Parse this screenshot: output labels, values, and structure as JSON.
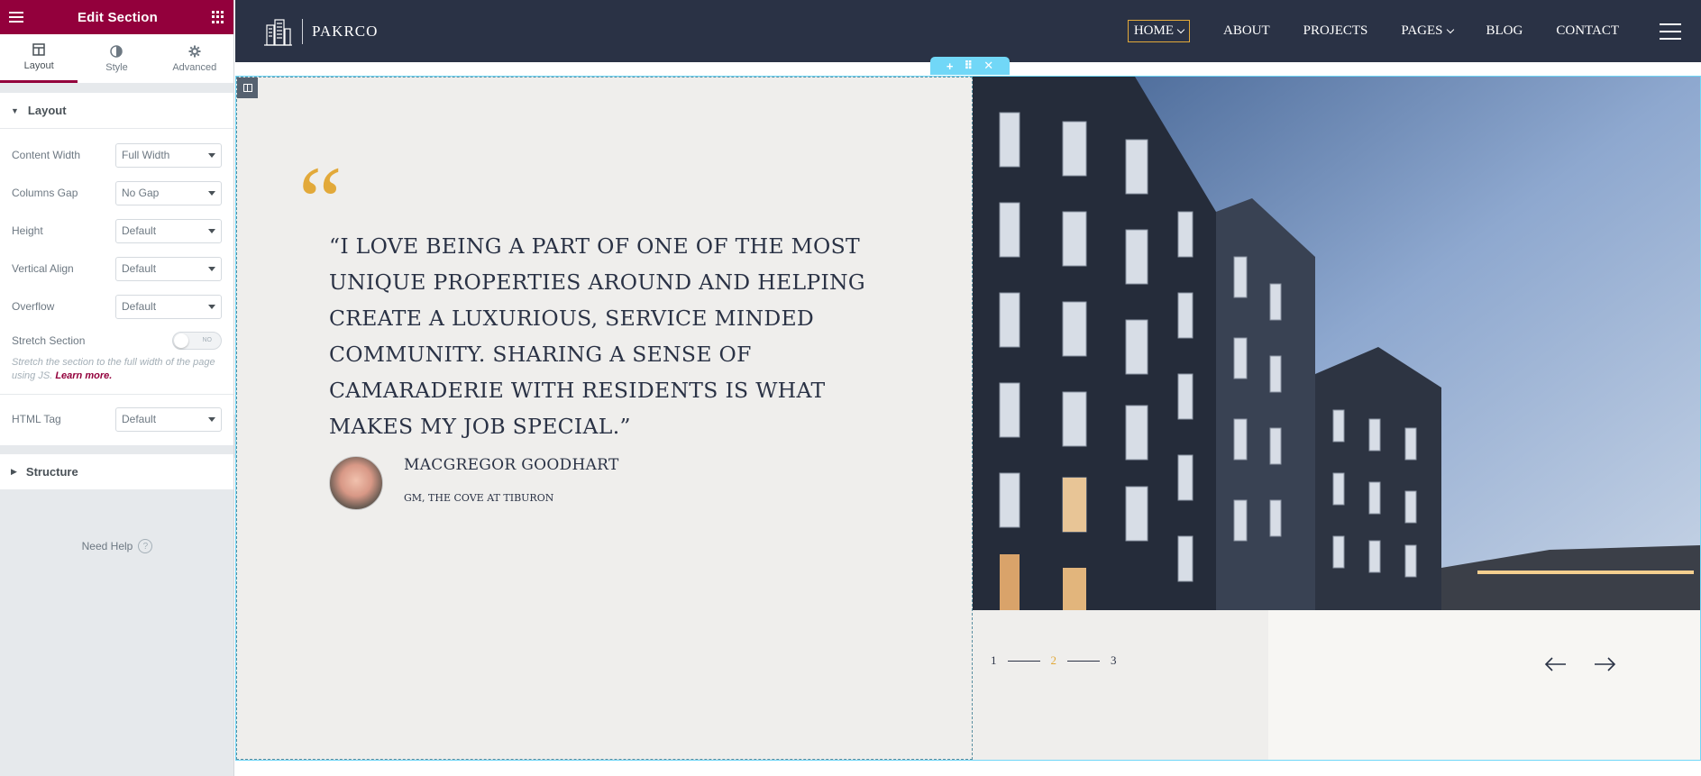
{
  "panel": {
    "title": "Edit Section",
    "tabs": [
      {
        "label": "Layout",
        "icon": "layout-icon"
      },
      {
        "label": "Style",
        "icon": "style-icon"
      },
      {
        "label": "Advanced",
        "icon": "gear-icon"
      }
    ],
    "layout_section_title": "Layout",
    "controls": {
      "content_width": {
        "label": "Content Width",
        "value": "Full Width"
      },
      "columns_gap": {
        "label": "Columns Gap",
        "value": "No Gap"
      },
      "height": {
        "label": "Height",
        "value": "Default"
      },
      "vertical_align": {
        "label": "Vertical Align",
        "value": "Default"
      },
      "overflow": {
        "label": "Overflow",
        "value": "Default"
      },
      "stretch_section": {
        "label": "Stretch Section",
        "toggle_text": "NO"
      },
      "html_tag": {
        "label": "HTML Tag",
        "value": "Default"
      }
    },
    "stretch_hint": "Stretch the section to the full width of the page using JS.",
    "learn_more": "Learn more.",
    "structure_section_title": "Structure",
    "need_help": "Need Help",
    "accent_color": "#93003c"
  },
  "site": {
    "logo_name": "PAKRCO",
    "nav": [
      {
        "label": "HOME",
        "has_dropdown": true,
        "active": true
      },
      {
        "label": "ABOUT"
      },
      {
        "label": "PROJECTS"
      },
      {
        "label": "PAGES",
        "has_dropdown": true
      },
      {
        "label": "BLOG"
      },
      {
        "label": "CONTACT"
      }
    ],
    "header_bg": "#2a3245",
    "accent_color": "#e2a93a",
    "testimonial": {
      "quote_mark": "“",
      "text": "“I love being a part of one of the most unique properties around and helping create a luxurious, service minded community. Sharing a sense of camaraderie with residents is what makes my job special.”",
      "author_name": "MacGregor Goodhart",
      "author_role": "GM, The Cove at Tiburon"
    },
    "pagination": {
      "pages": [
        "1",
        "2",
        "3"
      ],
      "active": "2"
    }
  }
}
